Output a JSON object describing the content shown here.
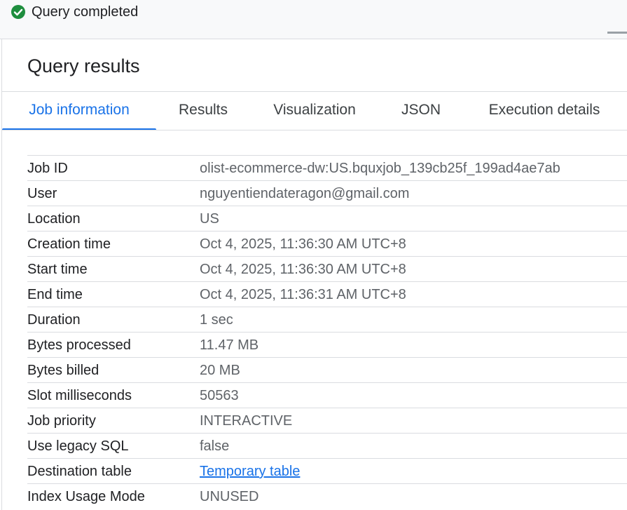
{
  "status": {
    "text": "Query completed",
    "icon": "check-circle-icon",
    "color": "#1e8e3e"
  },
  "title": "Query results",
  "tabs": [
    {
      "label": "Job information",
      "active": true
    },
    {
      "label": "Results",
      "active": false
    },
    {
      "label": "Visualization",
      "active": false
    },
    {
      "label": "JSON",
      "active": false
    },
    {
      "label": "Execution details",
      "active": false
    }
  ],
  "job_info": [
    {
      "label": "Job ID",
      "value": "olist-ecommerce-dw:US.bquxjob_139cb25f_199ad4ae7ab"
    },
    {
      "label": "User",
      "value": "nguyentiendateragon@gmail.com"
    },
    {
      "label": "Location",
      "value": "US"
    },
    {
      "label": "Creation time",
      "value": "Oct 4, 2025, 11:36:30 AM UTC+8"
    },
    {
      "label": "Start time",
      "value": "Oct 4, 2025, 11:36:30 AM UTC+8"
    },
    {
      "label": "End time",
      "value": "Oct 4, 2025, 11:36:31 AM UTC+8"
    },
    {
      "label": "Duration",
      "value": "1 sec"
    },
    {
      "label": "Bytes processed",
      "value": "11.47 MB"
    },
    {
      "label": "Bytes billed",
      "value": "20 MB"
    },
    {
      "label": "Slot milliseconds",
      "value": "50563"
    },
    {
      "label": "Job priority",
      "value": "INTERACTIVE"
    },
    {
      "label": "Use legacy SQL",
      "value": "false"
    },
    {
      "label": "Destination table",
      "value": "Temporary table",
      "link": true
    },
    {
      "label": "Index Usage Mode",
      "value": "UNUSED"
    }
  ],
  "colors": {
    "accent": "#1a73e8",
    "success": "#1e8e3e",
    "divider": "#dadce0"
  }
}
